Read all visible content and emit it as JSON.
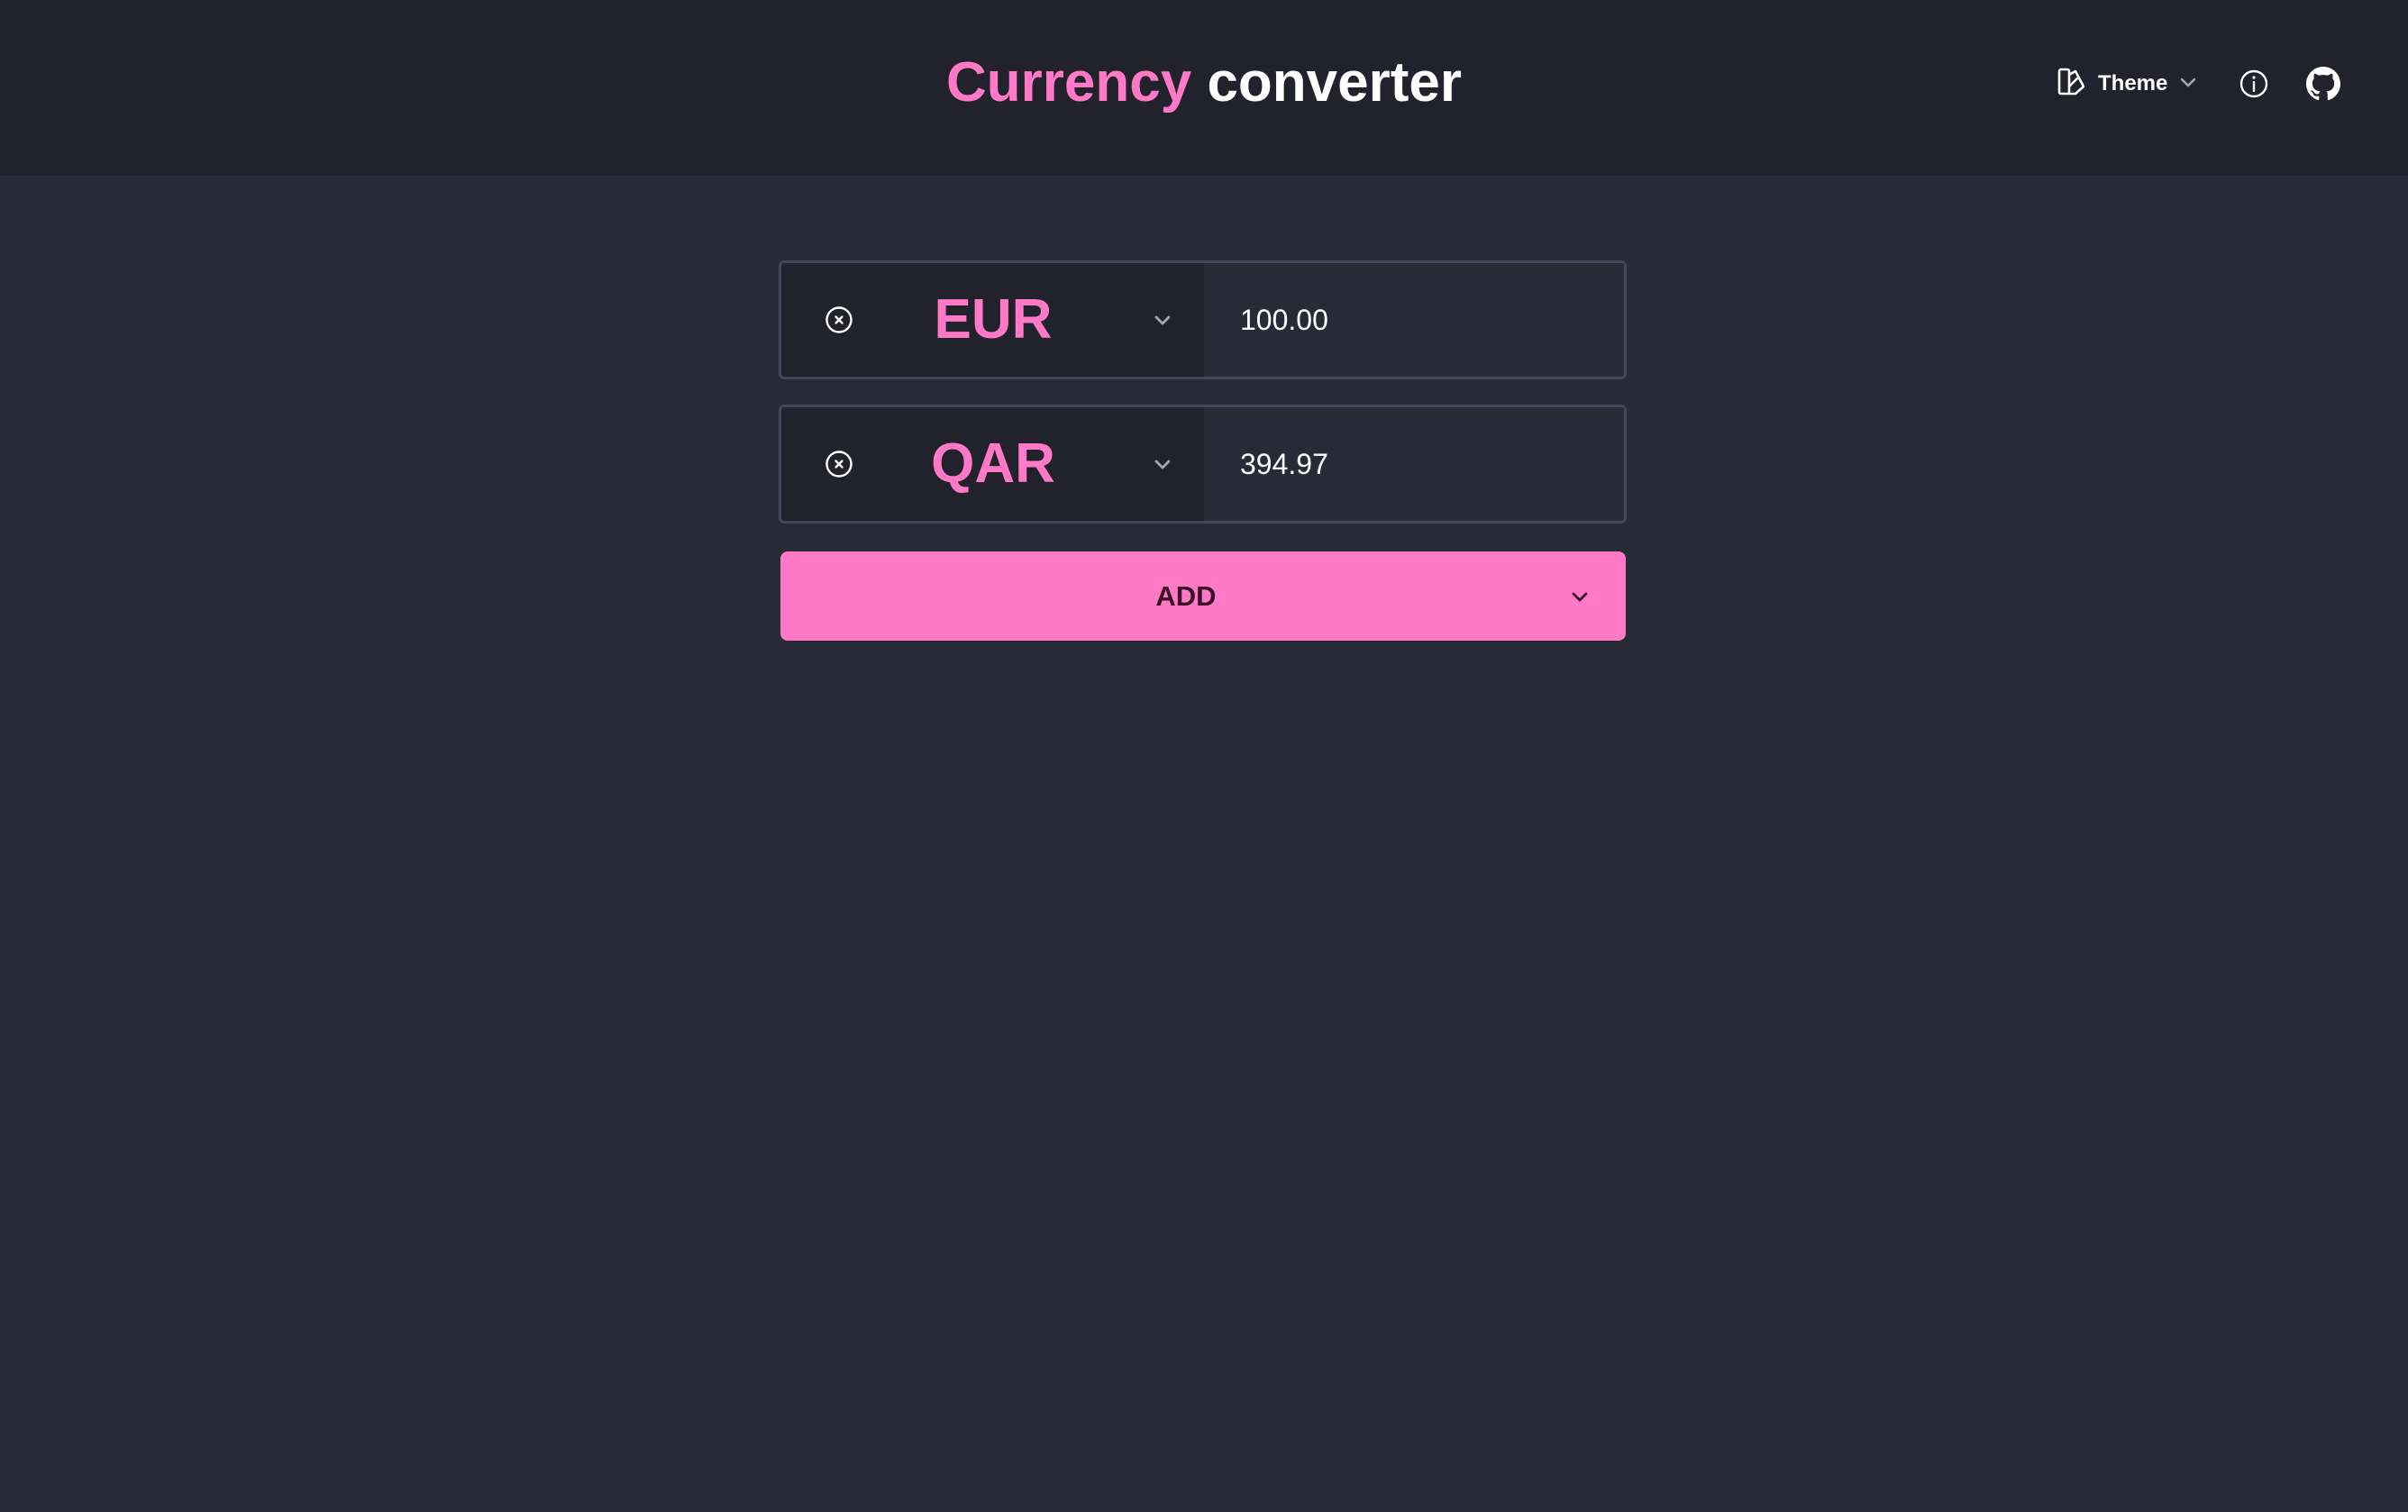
{
  "header": {
    "title_accent": "Currency",
    "title_rest": "converter",
    "theme_label": "Theme"
  },
  "rows": [
    {
      "code": "EUR",
      "amount": "100.00"
    },
    {
      "code": "QAR",
      "amount": "394.97"
    }
  ],
  "add_button": {
    "label": "ADD"
  },
  "icons": {
    "theme": "palette-icon",
    "theme_chevron": "chevron-down-icon",
    "info": "info-icon",
    "github": "github-icon",
    "remove": "close-circle-icon",
    "dropdown": "chevron-down-icon"
  },
  "colors": {
    "accent": "#ff79c6",
    "header_bg": "#21222c",
    "page_bg": "#282a36",
    "border": "#44475a"
  }
}
